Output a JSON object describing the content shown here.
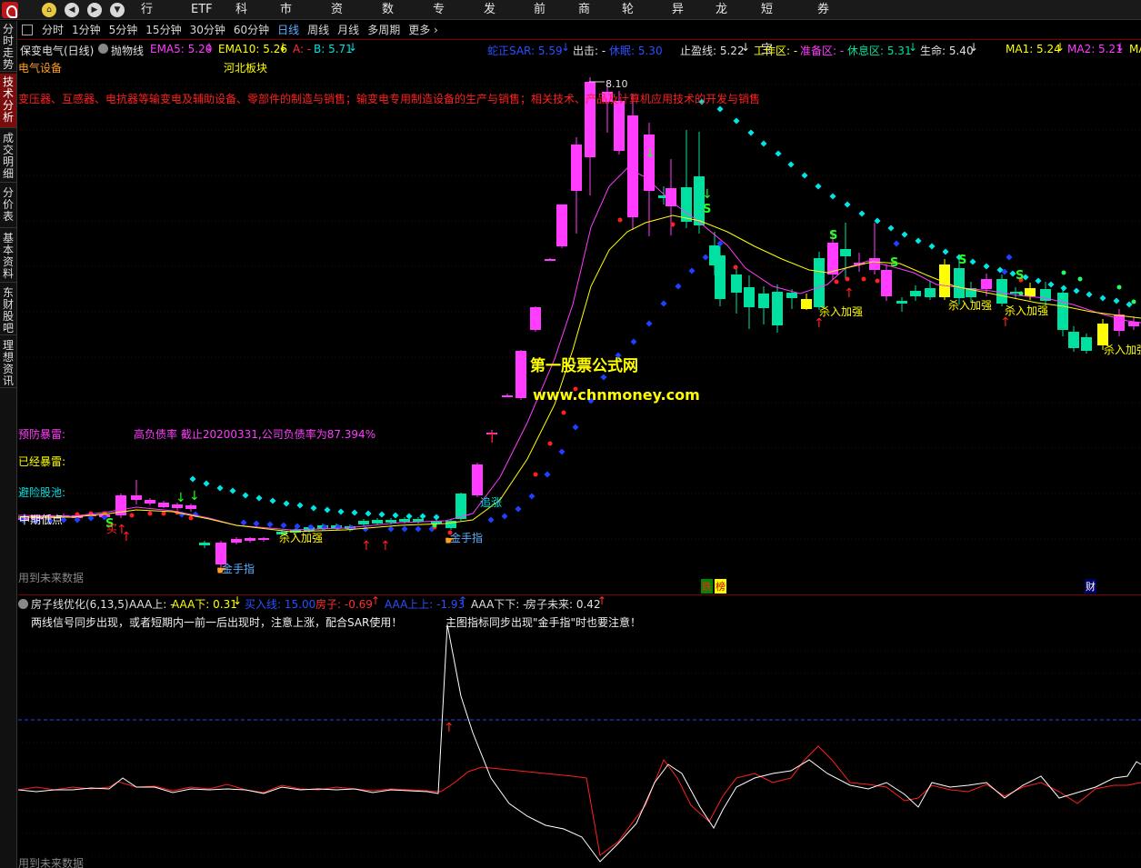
{
  "menu": [
    "行情",
    "ETF",
    "科创",
    "市场",
    "资讯",
    "数据",
    "专题",
    "发现",
    "前沿",
    "商品",
    "轮动",
    "异动",
    "龙虎",
    "短线宝",
    "券商"
  ],
  "periods": [
    "分时",
    "1分钟",
    "5分钟",
    "15分钟",
    "30分钟",
    "60分钟",
    "日线",
    "周线",
    "月线",
    "多周期",
    "更多"
  ],
  "active_period": "日线",
  "left_tabs": [
    "分时走势",
    "技术分析",
    "成交明细",
    "分价表",
    "基本资料",
    "东财股吧",
    "理想资讯"
  ],
  "active_left_tab": "技术分析",
  "main": {
    "stock_title": "保变电气(日线)",
    "indicator_name": "抛物线",
    "ema5": "EMA5: 5.20",
    "ema10": "EMA10: 5.26",
    "a_val": "A: -",
    "b_val": "B: 5.71",
    "sar_val": "蛇正SAR: 5.59",
    "exit_val": "出击: -",
    "rest_val": "休眠: 5.30",
    "stop_val": "止盈线: 5.22",
    "work_val": "工作区: -",
    "prep_val": "准备区: -",
    "rest_zone": "休息区: 5.31",
    "life_val": "生命: 5.40",
    "ma1": "MA1: 5.24",
    "ma2": "MA2: 5.21",
    "ma_more": "MA",
    "sector1": "电气设备",
    "sector2": "河北板块",
    "business": "变压器、互感器、电抗器等输变电及辅助设备、零部件的制造与销售；输变电专用制造设备的生产与销售；相关技术、产品及计算机应用技术的开发与销售",
    "peak_price": "8.10",
    "watermark1": "第一股票公式网",
    "watermark2": "www.chnmoney.com",
    "warn_label": "预防暴雷:",
    "warn_text": "高负债率 截止20200331,公司负债率为87.394%",
    "exploded_label": "已经暴雷:",
    "avoid_label": "避险股池:",
    "future_note": "用到未来数据",
    "signal_buy": "买",
    "signal_chase": "追涨",
    "signal_gold": "金手指",
    "signal_add": "杀入加强",
    "signal_low": "中期低点",
    "signal_s": "S",
    "badge1": "跌",
    "badge2": "榜",
    "badge3": "财"
  },
  "sub": {
    "title": "房子线优化(6,13,5)",
    "aaa_up": "AAA上: -",
    "aaa_down": "AAA下: 0.31",
    "buy_line": "买入线: 15.00",
    "house": "房子: -0.69",
    "aaa_upup": "AAA上上: -1.93",
    "aaa_downdown": "AAA下下: -",
    "house_future": "房子未来: 0.42",
    "note1": "两线信号同步出现，或者短期内一前一后出现时，注意上涨，配合SAR使用！",
    "note2": "主图指标同步出现\"金手指\"时也要注意！",
    "future_note": "用到未来数据"
  },
  "colors": {
    "up": "#ff3cff",
    "down": "#00e0a0",
    "yellow": "#ffff00",
    "sar_high": "#00e5e5",
    "sar_low": "#2040ff",
    "red": "#ff2020",
    "accent": "#5ab0ff"
  },
  "chart_data": [
    {
      "type": "candlestick",
      "title": "保变电气(日线)",
      "peak": 8.1,
      "last_close": 5.22
    },
    {
      "type": "line",
      "title": "房子线优化(6,13,5)",
      "series": [
        {
          "name": "AAA下",
          "color": "#ffffff"
        },
        {
          "name": "房子",
          "color": "#ff2020"
        }
      ]
    }
  ]
}
